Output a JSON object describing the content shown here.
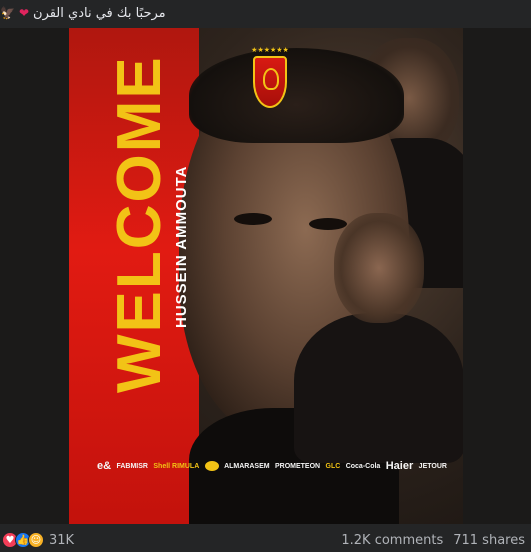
{
  "post": {
    "caption": "مرحبًا بك في نادي القرن",
    "caption_emojis": [
      "heart-icon",
      "eagle-icon"
    ]
  },
  "poster": {
    "headline": "WELCOME",
    "name": "HUSSEIN AMMOUTA",
    "crest_stars": "★★★★★★",
    "colors": {
      "red": "#e11b12",
      "yellow": "#f2c316",
      "dark": "#1b1a19"
    },
    "sponsors": [
      "e&",
      "FABMISR",
      "Shell RIMULA",
      "Lipton",
      "ALMARASEM",
      "PROMETEON",
      "GLC",
      "Coca-Cola",
      "Haier",
      "JETOUR"
    ]
  },
  "footer": {
    "reaction_icons": [
      "love-reaction-icon",
      "like-reaction-icon",
      "care-reaction-icon"
    ],
    "reaction_count": "31K",
    "comments": "1.2K comments",
    "shares": "711 shares"
  }
}
